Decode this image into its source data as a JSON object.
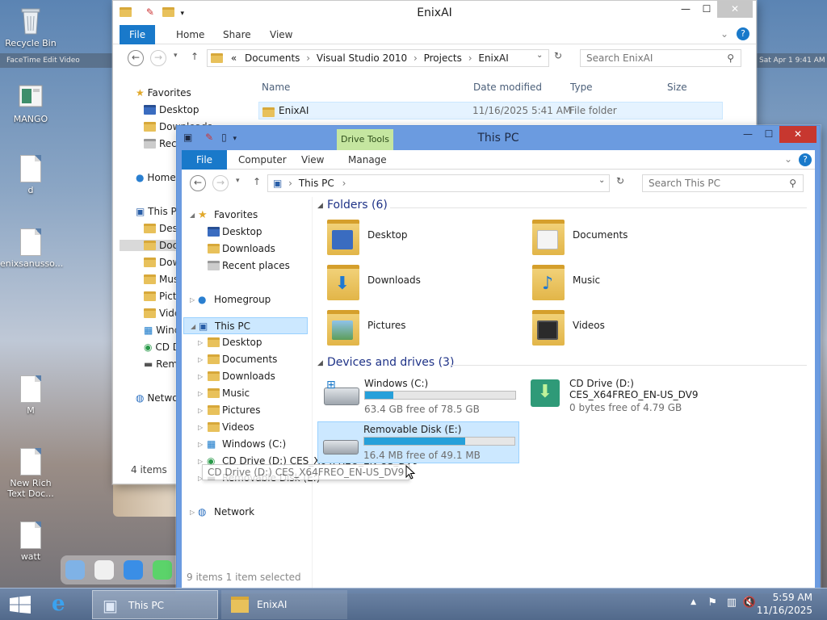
{
  "desktop": {
    "icons": [
      {
        "label": "Recycle Bin"
      },
      {
        "label": "MANGO"
      },
      {
        "label": "d"
      },
      {
        "label": "enixsanusso..."
      },
      {
        "label": "M"
      },
      {
        "label": "New Rich Text Doc..."
      },
      {
        "label": "watt"
      }
    ],
    "mac_menu_left": "FaceTime   Edit   Video",
    "mac_menu_right": "Sat Apr 1  9:41 AM"
  },
  "bg_window": {
    "title": "EnixAI",
    "tabs": [
      "File",
      "Home",
      "Share",
      "View"
    ],
    "address": [
      "«",
      "Documents",
      "Visual Studio 2010",
      "Projects",
      "EnixAI"
    ],
    "search_placeholder": "Search EnixAI",
    "nav": {
      "favorites": "Favorites",
      "items": [
        "Desktop",
        "Downloads",
        "Recent places"
      ],
      "homegroup": "Homegroup",
      "thispc": "This PC",
      "pc_items": [
        "Desktop",
        "Documents",
        "Downloads",
        "Music",
        "Pictures",
        "Videos",
        "Windows (C:)",
        "CD Drive (D:)",
        "Removable Disk (E:)"
      ],
      "network": "Network"
    },
    "columns": {
      "name": "Name",
      "date": "Date modified",
      "type": "Type",
      "size": "Size"
    },
    "rows": [
      {
        "name": "EnixAI",
        "date": "11/16/2025 5:41 AM",
        "type": "File folder"
      }
    ],
    "status": "4 items"
  },
  "fg_window": {
    "title": "This PC",
    "context_tab": "Drive Tools",
    "tabs": [
      "File",
      "Computer",
      "View",
      "Manage"
    ],
    "address": "This PC",
    "search_placeholder": "Search This PC",
    "nav": {
      "favorites": "Favorites",
      "fav_items": [
        "Desktop",
        "Downloads",
        "Recent places"
      ],
      "homegroup": "Homegroup",
      "thispc": "This PC",
      "pc_items": [
        "Desktop",
        "Documents",
        "Downloads",
        "Music",
        "Pictures",
        "Videos",
        "Windows (C:)",
        "CD Drive (D:) CES_X64FREO_EN-US_DV9",
        "Removable Disk (E:)"
      ],
      "network": "Network"
    },
    "folders_header": "Folders (6)",
    "folders": [
      "Desktop",
      "Documents",
      "Downloads",
      "Music",
      "Pictures",
      "Videos"
    ],
    "devices_header": "Devices and drives (3)",
    "drives": [
      {
        "name": "Windows (C:)",
        "free": "63.4 GB free of 78.5 GB",
        "used_fraction": 0.19
      },
      {
        "name": "CD Drive (D:)",
        "label": "CES_X64FREO_EN-US_DV9",
        "free": "0 bytes free of 4.79 GB"
      },
      {
        "name": "Removable Disk (E:)",
        "free": "16.4 MB free of 49.1 MB",
        "used_fraction": 0.67
      }
    ],
    "tooltip": "CD Drive (D:) CES_X64FREO_EN-US_DV9",
    "status": "9 items    1 item selected"
  },
  "taskbar": {
    "buttons": [
      "This PC",
      "EnixAI"
    ],
    "time": "5:59 AM",
    "date": "11/16/2025"
  },
  "colors": {
    "accent": "#1979ca",
    "titlebar_active": "#6b9be0",
    "selection": "#cce8ff",
    "drive_bar": "#26a0da"
  }
}
